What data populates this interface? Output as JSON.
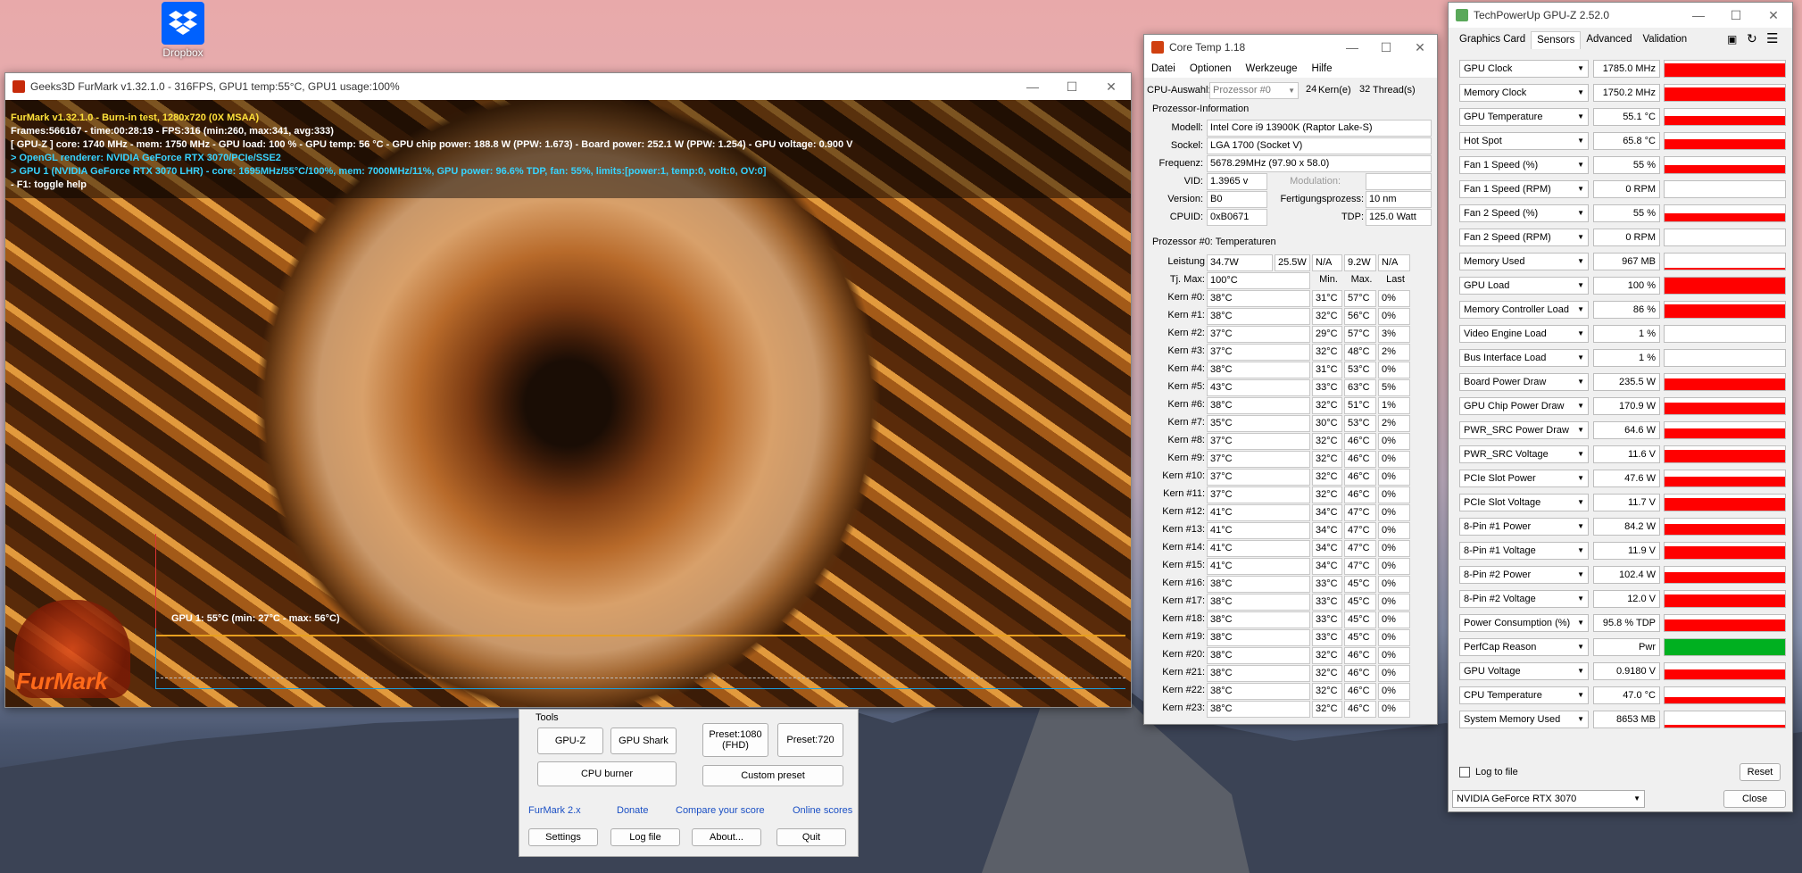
{
  "desktop": {
    "dropbox_label": "Dropbox"
  },
  "furmark": {
    "title": "Geeks3D FurMark v1.32.1.0 - 316FPS, GPU1 temp:55°C, GPU1 usage:100%",
    "lines": [
      "FurMark v1.32.1.0 - Burn-in test, 1280x720 (0X MSAA)",
      "Frames:566167 - time:00:28:19 - FPS:316 (min:260, max:341, avg:333)",
      "[ GPU-Z ] core: 1740 MHz - mem: 1750 MHz - GPU load: 100 % - GPU temp: 56 °C - GPU chip power: 188.8 W (PPW: 1.673) - Board power: 252.1 W (PPW: 1.254) - GPU voltage: 0.900 V",
      "> OpenGL renderer: NVIDIA GeForce RTX 3070/PCIe/SSE2",
      "> GPU 1 (NVIDIA GeForce RTX 3070 LHR) - core: 1695MHz/55°C/100%, mem: 7000MHz/11%, GPU power: 96.6% TDP, fan: 55%, limits:[power:1, temp:0, volt:0, OV:0]",
      "- F1: toggle help"
    ],
    "line_colors": [
      "#ffe23a",
      "#ffffff",
      "#ffffff",
      "#37d3ff",
      "#37d3ff",
      "#ffffff"
    ],
    "graph_label": "GPU 1: 55°C (min: 27°C - max: 56°C)",
    "logo_text": "FurMark"
  },
  "tools": {
    "header": "Tools",
    "gpuz": "GPU-Z",
    "gpushark": "GPU Shark",
    "cpuburner": "CPU burner",
    "preset1080": "Preset:1080 (FHD)",
    "preset720": "Preset:720",
    "custom": "Custom preset",
    "links": [
      "FurMark 2.x",
      "Donate",
      "Compare your score",
      "Online scores"
    ],
    "settings": "Settings",
    "logfile": "Log file",
    "about": "About...",
    "quit": "Quit"
  },
  "coretemp": {
    "title": "Core Temp 1.18",
    "menu": [
      "Datei",
      "Optionen",
      "Werkzeuge",
      "Hilfe"
    ],
    "cpu_select_label": "CPU-Auswahl:",
    "cpu_select": "Prozessor #0",
    "cores": "24",
    "cores_label": "Kern(e)",
    "threads": "32",
    "threads_label": "Thread(s)",
    "info_header": "Prozessor-Information",
    "model_label": "Modell:",
    "model": "Intel Core i9 13900K (Raptor Lake-S)",
    "socket_label": "Sockel:",
    "socket": "LGA 1700 (Socket V)",
    "freq_label": "Frequenz:",
    "freq": "5678.29MHz (97.90 x 58.0)",
    "vid_label": "VID:",
    "vid": "1.3965 v",
    "mod_label": "Modulation:",
    "version_label": "Version:",
    "version": "B0",
    "process_label": "Fertigungsprozess:",
    "process": "10 nm",
    "cpuid_label": "CPUID:",
    "cpuid": "0xB0671",
    "tdp_label": "TDP:",
    "tdp": "125.0 Watt",
    "temp_header": "Prozessor #0: Temperaturen",
    "power_label": "Leistung",
    "power": [
      "34.7W",
      "25.5W",
      "N/A",
      "9.2W",
      "N/A"
    ],
    "tjmax_label": "Tj. Max:",
    "tjmax": "100°C",
    "col_min": "Min.",
    "col_max": "Max.",
    "col_last": "Last",
    "cores_rows": [
      [
        "Kern #0:",
        "38°C",
        "31°C",
        "57°C",
        "0%"
      ],
      [
        "Kern #1:",
        "38°C",
        "32°C",
        "56°C",
        "0%"
      ],
      [
        "Kern #2:",
        "37°C",
        "29°C",
        "57°C",
        "3%"
      ],
      [
        "Kern #3:",
        "37°C",
        "32°C",
        "48°C",
        "2%"
      ],
      [
        "Kern #4:",
        "38°C",
        "31°C",
        "53°C",
        "0%"
      ],
      [
        "Kern #5:",
        "43°C",
        "33°C",
        "63°C",
        "5%"
      ],
      [
        "Kern #6:",
        "38°C",
        "32°C",
        "51°C",
        "1%"
      ],
      [
        "Kern #7:",
        "35°C",
        "30°C",
        "53°C",
        "2%"
      ],
      [
        "Kern #8:",
        "37°C",
        "32°C",
        "46°C",
        "0%"
      ],
      [
        "Kern #9:",
        "37°C",
        "32°C",
        "46°C",
        "0%"
      ],
      [
        "Kern #10:",
        "37°C",
        "32°C",
        "46°C",
        "0%"
      ],
      [
        "Kern #11:",
        "37°C",
        "32°C",
        "46°C",
        "0%"
      ],
      [
        "Kern #12:",
        "41°C",
        "34°C",
        "47°C",
        "0%"
      ],
      [
        "Kern #13:",
        "41°C",
        "34°C",
        "47°C",
        "0%"
      ],
      [
        "Kern #14:",
        "41°C",
        "34°C",
        "47°C",
        "0%"
      ],
      [
        "Kern #15:",
        "41°C",
        "34°C",
        "47°C",
        "0%"
      ],
      [
        "Kern #16:",
        "38°C",
        "33°C",
        "45°C",
        "0%"
      ],
      [
        "Kern #17:",
        "38°C",
        "33°C",
        "45°C",
        "0%"
      ],
      [
        "Kern #18:",
        "38°C",
        "33°C",
        "45°C",
        "0%"
      ],
      [
        "Kern #19:",
        "38°C",
        "33°C",
        "45°C",
        "0%"
      ],
      [
        "Kern #20:",
        "38°C",
        "32°C",
        "46°C",
        "0%"
      ],
      [
        "Kern #21:",
        "38°C",
        "32°C",
        "46°C",
        "0%"
      ],
      [
        "Kern #22:",
        "38°C",
        "32°C",
        "46°C",
        "0%"
      ],
      [
        "Kern #23:",
        "38°C",
        "32°C",
        "46°C",
        "0%"
      ]
    ]
  },
  "gpuz": {
    "title": "TechPowerUp GPU-Z 2.52.0",
    "tabs": [
      "Graphics Card",
      "Sensors",
      "Advanced",
      "Validation"
    ],
    "sensors": [
      {
        "name": "GPU Clock",
        "value": "1785.0 MHz",
        "level": 0.85,
        "color": "#ff0000"
      },
      {
        "name": "Memory Clock",
        "value": "1750.2 MHz",
        "level": 0.85,
        "color": "#ff0000"
      },
      {
        "name": "GPU Temperature",
        "value": "55.1 °C",
        "level": 0.55,
        "color": "#ff0000"
      },
      {
        "name": "Hot Spot",
        "value": "65.8 °C",
        "level": 0.6,
        "color": "#ff0000"
      },
      {
        "name": "Fan 1 Speed (%)",
        "value": "55 %",
        "level": 0.5,
        "color": "#ff0000"
      },
      {
        "name": "Fan 1 Speed (RPM)",
        "value": "0 RPM",
        "level": 0,
        "color": "#ff0000"
      },
      {
        "name": "Fan 2 Speed (%)",
        "value": "55 %",
        "level": 0.5,
        "color": "#ff0000"
      },
      {
        "name": "Fan 2 Speed (RPM)",
        "value": "0 RPM",
        "level": 0,
        "color": "#ff0000"
      },
      {
        "name": "Memory Used",
        "value": "967 MB",
        "level": 0.12,
        "color": "#ff0000"
      },
      {
        "name": "GPU Load",
        "value": "100 %",
        "level": 1,
        "color": "#ff0000"
      },
      {
        "name": "Memory Controller Load",
        "value": "86 %",
        "level": 0.86,
        "color": "#ff0000"
      },
      {
        "name": "Video Engine Load",
        "value": "1 %",
        "level": 0.01,
        "color": "#ff0000"
      },
      {
        "name": "Bus Interface Load",
        "value": "1 %",
        "level": 0.01,
        "color": "#ff0000"
      },
      {
        "name": "Board Power Draw",
        "value": "235.5 W",
        "level": 0.75,
        "color": "#ff0000"
      },
      {
        "name": "GPU Chip Power Draw",
        "value": "170.9 W",
        "level": 0.7,
        "color": "#ff0000"
      },
      {
        "name": "PWR_SRC Power Draw",
        "value": "64.6 W",
        "level": 0.6,
        "color": "#ff0000"
      },
      {
        "name": "PWR_SRC Voltage",
        "value": "11.6 V",
        "level": 0.8,
        "color": "#ff0000"
      },
      {
        "name": "PCIe Slot Power",
        "value": "47.6 W",
        "level": 0.6,
        "color": "#ff0000"
      },
      {
        "name": "PCIe Slot Voltage",
        "value": "11.7 V",
        "level": 0.8,
        "color": "#ff0000"
      },
      {
        "name": "8-Pin #1 Power",
        "value": "84.2 W",
        "level": 0.65,
        "color": "#ff0000"
      },
      {
        "name": "8-Pin #1 Voltage",
        "value": "11.9 V",
        "level": 0.8,
        "color": "#ff0000"
      },
      {
        "name": "8-Pin #2 Power",
        "value": "102.4 W",
        "level": 0.65,
        "color": "#ff0000"
      },
      {
        "name": "8-Pin #2 Voltage",
        "value": "12.0 V",
        "level": 0.8,
        "color": "#ff0000"
      },
      {
        "name": "Power Consumption (%)",
        "value": "95.8 % TDP",
        "level": 0.75,
        "color": "#ff0000"
      },
      {
        "name": "PerfCap Reason",
        "value": "Pwr",
        "level": 1,
        "color": "#00b020"
      },
      {
        "name": "GPU Voltage",
        "value": "0.9180 V",
        "level": 0.6,
        "color": "#ff0000"
      },
      {
        "name": "CPU Temperature",
        "value": "47.0 °C",
        "level": 0.4,
        "color": "#ff0000"
      },
      {
        "name": "System Memory Used",
        "value": "8653 MB",
        "level": 0.15,
        "color": "#ff0000"
      }
    ],
    "log_label": "Log to file",
    "reset": "Reset",
    "device": "NVIDIA GeForce RTX 3070",
    "close": "Close"
  }
}
